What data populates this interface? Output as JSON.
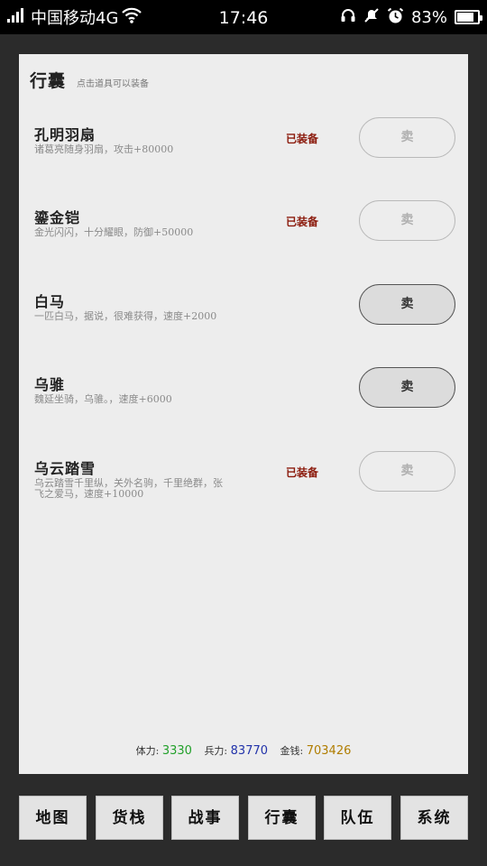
{
  "status_bar": {
    "carrier": "中国移动4G",
    "time": "17:46",
    "battery": "83%",
    "battery_level": 0.83,
    "icons": [
      "signal-icon",
      "wifi-icon",
      "headset-icon",
      "muted-icon",
      "alarm-icon",
      "battery-icon"
    ]
  },
  "panel": {
    "title": "行囊",
    "hint": "点击道具可以装备"
  },
  "items": [
    {
      "name": "孔明羽扇",
      "desc": "诸葛亮随身羽扇，攻击+80000",
      "equipped": "已装备",
      "sell": "卖",
      "sellable": false
    },
    {
      "name": "鎏金铠",
      "desc": "金光闪闪，十分耀眼，防御+50000",
      "equipped": "已装备",
      "sell": "卖",
      "sellable": false
    },
    {
      "name": "白马",
      "desc": "一匹白马，据说，很难获得，速度+2000",
      "equipped": "",
      "sell": "卖",
      "sellable": true
    },
    {
      "name": "乌骓",
      "desc": "魏延坐骑，乌骓。，速度+6000",
      "equipped": "",
      "sell": "卖",
      "sellable": true
    },
    {
      "name": "乌云踏雪",
      "desc": "乌云踏雪千里纵，关外名驹，千里绝群，张飞之爱马，速度+10000",
      "equipped": "已装备",
      "sell": "卖",
      "sellable": false
    }
  ],
  "stats": {
    "stamina_label": "体力:",
    "stamina": "3330",
    "troops_label": "兵力:",
    "troops": "83770",
    "gold_label": "金钱:",
    "gold": "703426"
  },
  "colors": {
    "stamina": "#22a02a",
    "troops": "#2233aa",
    "gold": "#b07d00",
    "equipped": "#8b1a0c"
  },
  "nav": [
    {
      "label": "地图"
    },
    {
      "label": "货栈"
    },
    {
      "label": "战事"
    },
    {
      "label": "行囊",
      "active": true
    },
    {
      "label": "队伍"
    },
    {
      "label": "系统"
    }
  ]
}
